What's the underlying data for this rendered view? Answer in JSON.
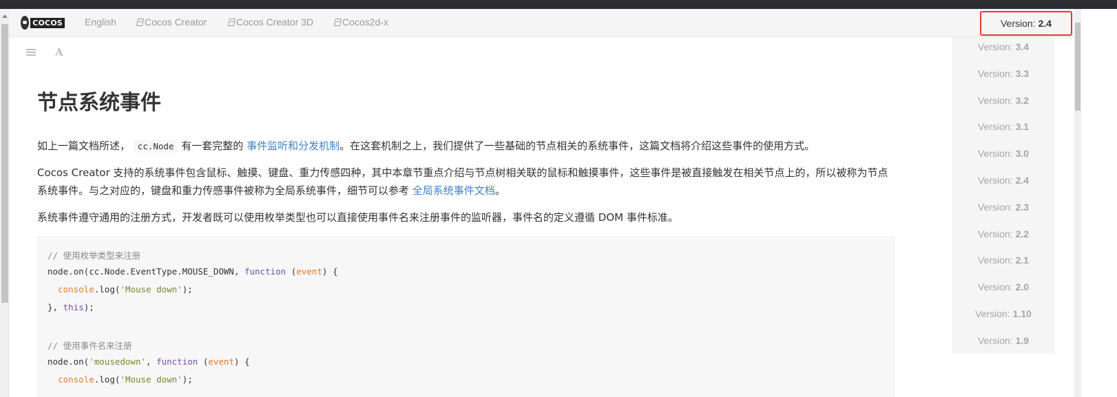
{
  "nav": {
    "logo_text": "COCOS",
    "links": [
      {
        "label": "English",
        "icon": ""
      },
      {
        "label": "Cocos Creator",
        "icon": "book-icon"
      },
      {
        "label": "Cocos Creator 3D",
        "icon": "book-icon"
      },
      {
        "label": "Cocos2d-x",
        "icon": "book-icon"
      }
    ],
    "current_version_label": "Version:",
    "current_version_value": "2.4"
  },
  "toolbar": {
    "menu_icon": "menu-icon",
    "font_icon_glyph": "A"
  },
  "article": {
    "title": "节点系统事件",
    "p1": {
      "before": "如上一篇文档所述，",
      "code": "cc.Node",
      "middle": "有一套完整的",
      "link": "事件监听和分发机制",
      "after": "。在这套机制之上，我们提供了一些基础的节点相关的系统事件，这篇文档将介绍这些事件的使用方式。"
    },
    "p2": {
      "text": "Cocos Creator 支持的系统事件包含鼠标、触摸、键盘、重力传感四种，其中本章节重点介绍与节点树相关联的鼠标和触摸事件，这些事件是被直接触发在相关节点上的，所以被称为节点系统事件。与之对应的，键盘和重力传感事件被称为全局系统事件，细节可以参考",
      "link": "全局系统事件文档",
      "after": "。"
    },
    "p3": "系统事件遵守通用的注册方式，开发者既可以使用枚举类型也可以直接使用事件名来注册事件的监听器，事件名的定义遵循 DOM 事件标准。",
    "code": {
      "l1": "// 使用枚举类型来注册",
      "l2_a": "node.on(cc.Node.EventType.MOUSE_DOWN, ",
      "l2_kw": "function",
      "l2_b": " (",
      "l2_param": "event",
      "l2_c": ") {",
      "l3_indent": "  ",
      "l3_builtin": "console",
      "l3_a": ".log(",
      "l3_str": "'Mouse down'",
      "l3_b": ");",
      "l4_a": "}, ",
      "l4_kw": "this",
      "l4_b": ");",
      "l6": "// 使用事件名来注册",
      "l7_a": "node.on(",
      "l7_str": "'mousedown'",
      "l7_b": ", ",
      "l7_kw": "function",
      "l7_c": " (",
      "l7_param": "event",
      "l7_d": ") {",
      "l8_indent": "  ",
      "l8_builtin": "console",
      "l8_a": ".log(",
      "l8_str": "'Mouse down'",
      "l8_b": ");"
    }
  },
  "versions": {
    "label": "Version:",
    "items": [
      "3.4",
      "3.3",
      "3.2",
      "3.1",
      "3.0",
      "2.4",
      "2.3",
      "2.2",
      "2.1",
      "2.0",
      "1.10",
      "1.9"
    ]
  },
  "colors": {
    "link": "#4183c4",
    "highlight_border": "#e53935",
    "code_bg": "#f7f7f7"
  }
}
